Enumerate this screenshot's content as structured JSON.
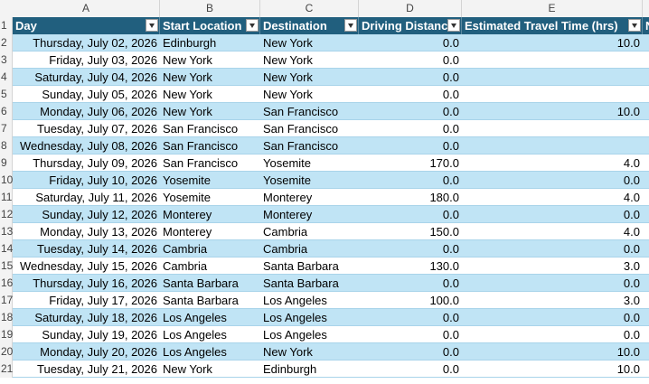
{
  "columns": [
    "A",
    "B",
    "C",
    "D",
    "E"
  ],
  "header": {
    "day": "Day",
    "start": "Start Location",
    "dest": "Destination",
    "dist": "Driving Distanc",
    "time": "Estimated Travel Time (hrs)",
    "next": "N"
  },
  "rows": [
    {
      "num": "2",
      "day": "Thursday, July 02, 2026",
      "start": "Edinburgh",
      "dest": "New York",
      "dist": "0.0",
      "time": "10.0"
    },
    {
      "num": "3",
      "day": "Friday, July 03, 2026",
      "start": "New York",
      "dest": "New York",
      "dist": "0.0",
      "time": ""
    },
    {
      "num": "4",
      "day": "Saturday, July 04, 2026",
      "start": "New York",
      "dest": "New York",
      "dist": "0.0",
      "time": ""
    },
    {
      "num": "5",
      "day": "Sunday, July 05, 2026",
      "start": "New York",
      "dest": "New York",
      "dist": "0.0",
      "time": ""
    },
    {
      "num": "6",
      "day": "Monday, July 06, 2026",
      "start": "New York",
      "dest": "San Francisco",
      "dist": "0.0",
      "time": "10.0"
    },
    {
      "num": "7",
      "day": "Tuesday, July 07, 2026",
      "start": "San Francisco",
      "dest": "San Francisco",
      "dist": "0.0",
      "time": ""
    },
    {
      "num": "8",
      "day": "Wednesday, July 08, 2026",
      "start": "San Francisco",
      "dest": "San Francisco",
      "dist": "0.0",
      "time": ""
    },
    {
      "num": "9",
      "day": "Thursday, July 09, 2026",
      "start": "San Francisco",
      "dest": "Yosemite",
      "dist": "170.0",
      "time": "4.0"
    },
    {
      "num": "10",
      "day": "Friday, July 10, 2026",
      "start": "Yosemite",
      "dest": "Yosemite",
      "dist": "0.0",
      "time": "0.0"
    },
    {
      "num": "11",
      "day": "Saturday, July 11, 2026",
      "start": "Yosemite",
      "dest": "Monterey",
      "dist": "180.0",
      "time": "4.0"
    },
    {
      "num": "12",
      "day": "Sunday, July 12, 2026",
      "start": "Monterey",
      "dest": "Monterey",
      "dist": "0.0",
      "time": "0.0"
    },
    {
      "num": "13",
      "day": "Monday, July 13, 2026",
      "start": "Monterey",
      "dest": "Cambria",
      "dist": "150.0",
      "time": "4.0"
    },
    {
      "num": "14",
      "day": "Tuesday, July 14, 2026",
      "start": "Cambria",
      "dest": "Cambria",
      "dist": "0.0",
      "time": "0.0"
    },
    {
      "num": "15",
      "day": "Wednesday, July 15, 2026",
      "start": "Cambria",
      "dest": "Santa Barbara",
      "dist": "130.0",
      "time": "3.0"
    },
    {
      "num": "16",
      "day": "Thursday, July 16, 2026",
      "start": "Santa Barbara",
      "dest": "Santa Barbara",
      "dist": "0.0",
      "time": "0.0"
    },
    {
      "num": "17",
      "day": "Friday, July 17, 2026",
      "start": "Santa Barbara",
      "dest": "Los Angeles",
      "dist": "100.0",
      "time": "3.0"
    },
    {
      "num": "18",
      "day": "Saturday, July 18, 2026",
      "start": "Los Angeles",
      "dest": "Los Angeles",
      "dist": "0.0",
      "time": "0.0"
    },
    {
      "num": "19",
      "day": "Sunday, July 19, 2026",
      "start": "Los Angeles",
      "dest": "Los Angeles",
      "dist": "0.0",
      "time": "0.0"
    },
    {
      "num": "20",
      "day": "Monday, July 20, 2026",
      "start": "Los Angeles",
      "dest": "New York",
      "dist": "0.0",
      "time": "10.0"
    },
    {
      "num": "21",
      "day": "Tuesday, July 21, 2026",
      "start": "New York",
      "dest": "Edinburgh",
      "dist": "0.0",
      "time": "10.0"
    }
  ],
  "header_row_num": "1",
  "colors": {
    "header_bg": "#215f7e",
    "band": "#c0e4f5"
  }
}
